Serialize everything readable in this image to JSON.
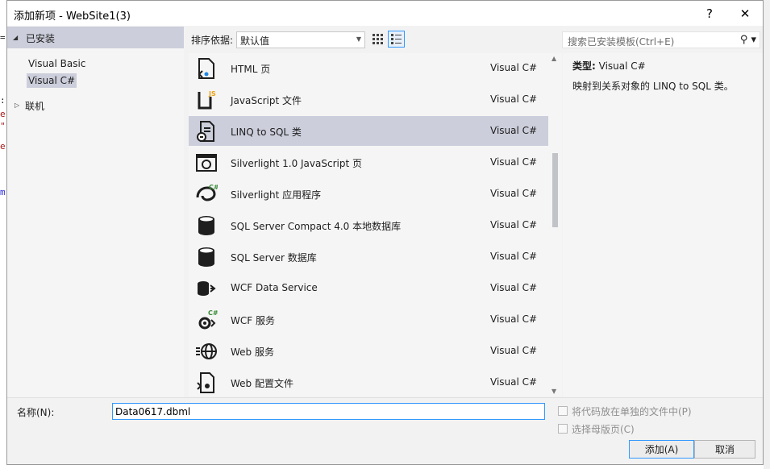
{
  "window": {
    "title": "添加新项 - WebSite1(3)",
    "help_label": "?",
    "close_label": "✕"
  },
  "tree": {
    "root_label": "已安装",
    "items": [
      {
        "label": "Visual Basic",
        "selected": false
      },
      {
        "label": "Visual C#",
        "selected": true
      }
    ],
    "online_label": "联机"
  },
  "toolbar": {
    "sort_label": "排序依据:",
    "sort_value": "默认值",
    "view_modes": [
      "grid-view-icon",
      "list-view-icon"
    ],
    "active_view": "list-view-icon"
  },
  "search": {
    "placeholder": "搜索已安装模板(Ctrl+E)"
  },
  "templates": [
    {
      "name": "HTML 页",
      "lang": "Visual C#",
      "icon": "html-page-icon",
      "selected": false
    },
    {
      "name": "JavaScript 文件",
      "lang": "Visual C#",
      "icon": "javascript-file-icon",
      "selected": false
    },
    {
      "name": "LINQ to SQL 类",
      "lang": "Visual C#",
      "icon": "linq-to-sql-icon",
      "selected": true
    },
    {
      "name": "Silverlight 1.0 JavaScript 页",
      "lang": "Visual C#",
      "icon": "silverlight-page-icon",
      "selected": false
    },
    {
      "name": "Silverlight 应用程序",
      "lang": "Visual C#",
      "icon": "silverlight-app-icon",
      "selected": false
    },
    {
      "name": "SQL Server Compact 4.0 本地数据库",
      "lang": "Visual C#",
      "icon": "database-icon",
      "selected": false
    },
    {
      "name": "SQL Server 数据库",
      "lang": "Visual C#",
      "icon": "database-icon",
      "selected": false
    },
    {
      "name": "WCF Data Service",
      "lang": "Visual C#",
      "icon": "wcf-data-service-icon",
      "selected": false
    },
    {
      "name": "WCF 服务",
      "lang": "Visual C#",
      "icon": "wcf-service-icon",
      "selected": false
    },
    {
      "name": "Web 服务",
      "lang": "Visual C#",
      "icon": "web-service-icon",
      "selected": false
    },
    {
      "name": "Web 配置文件",
      "lang": "Visual C#",
      "icon": "web-config-icon",
      "selected": false
    }
  ],
  "info": {
    "type_label": "类型:",
    "type_value": "Visual C#",
    "description": "映射到关系对象的 LINQ to SQL 类。"
  },
  "form": {
    "name_label": "名称(N):",
    "name_value": "Data0617.dbml",
    "checkbox_separate_file": "将代码放在单独的文件中(P)",
    "checkbox_master_page": "选择母版页(C)",
    "add_button": "添加(A)",
    "cancel_button": "取消"
  },
  "colors": {
    "selection": "#cccedb",
    "accent": "#3399ff",
    "dialog_bg": "#f2f2f2"
  }
}
